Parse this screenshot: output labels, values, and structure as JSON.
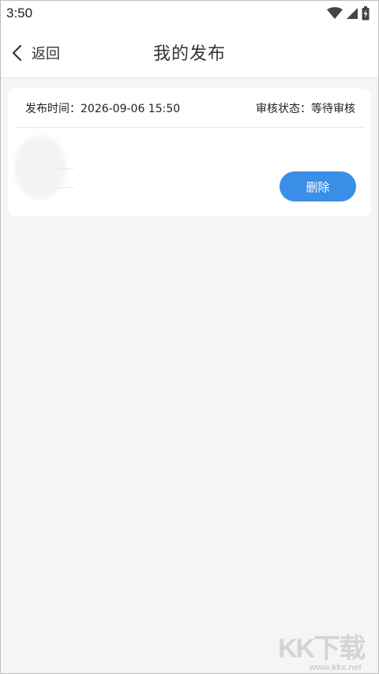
{
  "status_bar": {
    "time": "3:50",
    "icons": [
      "wifi-icon",
      "signal-icon",
      "battery-charging-icon"
    ]
  },
  "nav": {
    "back_label": "返回",
    "title": "我的发布"
  },
  "posts": [
    {
      "publish_time_label": "发布时间：",
      "publish_time_value": "2026-09-06 15:50",
      "review_status_label": "审核状态：",
      "review_status_value": "等待审核",
      "delete_label": "删除"
    }
  ],
  "watermark": {
    "text": "KK下载",
    "url": "www.kkx.net"
  },
  "colors": {
    "accent": "#3a8ee6",
    "background": "#f5f5f6",
    "card": "#ffffff"
  }
}
